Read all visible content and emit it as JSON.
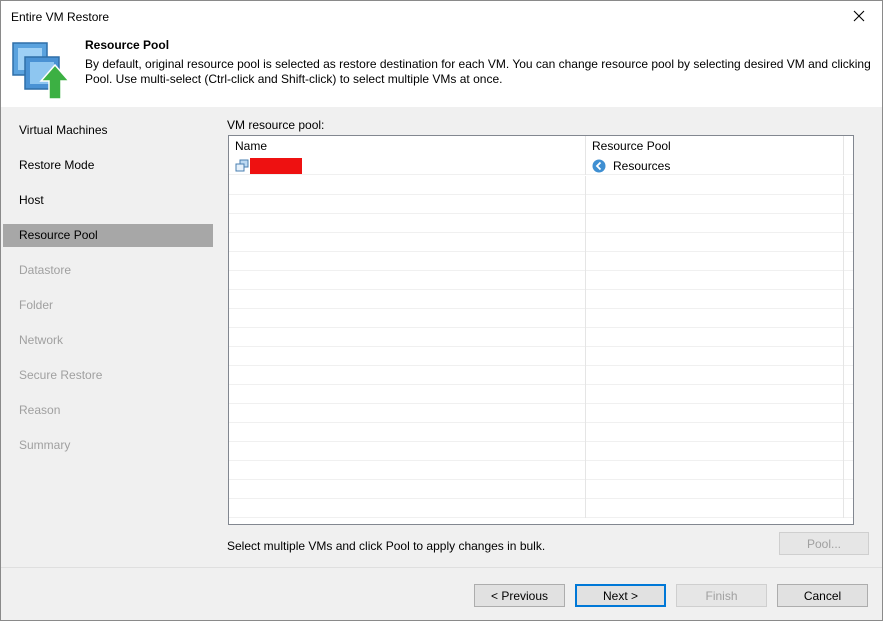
{
  "window": {
    "title": "Entire VM Restore"
  },
  "header": {
    "title": "Resource Pool",
    "description": "By default, original resource pool is selected as restore destination for each VM. You can change resource pool by selecting desired VM and clicking Pool. Use multi-select (Ctrl-click and Shift-click) to select multiple VMs at once."
  },
  "sidebar": {
    "items": [
      {
        "label": "Virtual Machines",
        "state": "enabled"
      },
      {
        "label": "Restore Mode",
        "state": "enabled"
      },
      {
        "label": "Host",
        "state": "enabled"
      },
      {
        "label": "Resource Pool",
        "state": "active"
      },
      {
        "label": "Datastore",
        "state": "disabled"
      },
      {
        "label": "Folder",
        "state": "disabled"
      },
      {
        "label": "Network",
        "state": "disabled"
      },
      {
        "label": "Secure Restore",
        "state": "disabled"
      },
      {
        "label": "Reason",
        "state": "disabled"
      },
      {
        "label": "Summary",
        "state": "disabled"
      }
    ]
  },
  "main": {
    "grid_label": "VM resource pool:",
    "columns": [
      "Name",
      "Resource Pool"
    ],
    "rows": [
      {
        "name": "",
        "name_redacted": true,
        "resource_pool": "Resources"
      }
    ],
    "hint": "Select multiple VMs and click Pool to apply changes in bulk.",
    "pool_button": "Pool..."
  },
  "footer": {
    "previous": "< Previous",
    "next": "Next >",
    "finish": "Finish",
    "cancel": "Cancel"
  },
  "colors": {
    "active_nav": "#a7a7a7",
    "redaction": "#ee1111",
    "default_button_border": "#0078d7",
    "icon_blue": "#3f8fd2",
    "icon_green": "#3cb043"
  }
}
